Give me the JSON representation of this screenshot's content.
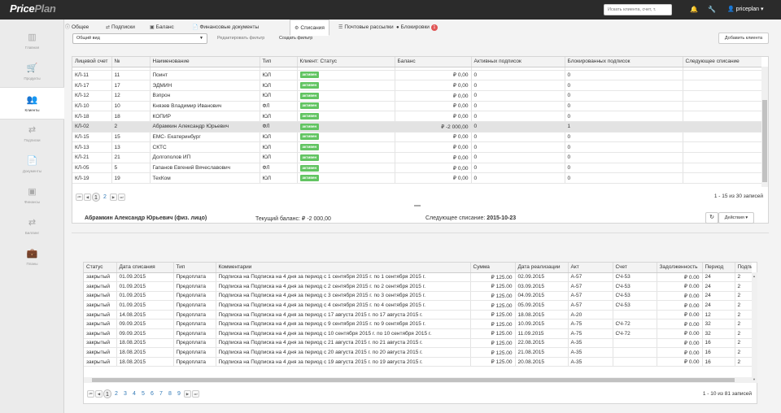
{
  "app": {
    "logo_part1": "Price",
    "logo_part2": "Plan"
  },
  "topbar": {
    "search_placeholder": "Искать клиента, счет, т.",
    "user": "priceplan"
  },
  "sidebar": [
    {
      "label": "Главная",
      "icon": "chart-icon"
    },
    {
      "label": "Продукты",
      "icon": "cart-icon"
    },
    {
      "label": "Клиенты",
      "icon": "users-icon",
      "active": true
    },
    {
      "label": "Подписки",
      "icon": "refresh-icon"
    },
    {
      "label": "Документы",
      "icon": "document-icon"
    },
    {
      "label": "Финансы",
      "icon": "money-icon"
    },
    {
      "label": "Биллинг",
      "icon": "billing-icon"
    },
    {
      "label": "Планы",
      "icon": "briefcase-icon"
    }
  ],
  "toolbar": {
    "view_select": "Общий вид",
    "edit_filter": "Редактировать фильтр",
    "create_filter": "Создать фильтр",
    "add_client": "Добавить клиента"
  },
  "clients": {
    "columns": [
      "Лицевой счет",
      "№",
      "Наименование",
      "Тип",
      "Клиент: Статус",
      "Баланс",
      "Активных подписок",
      "Блокированных подписок",
      "Следующее списание"
    ],
    "rows": [
      [
        "КЛ-11",
        "11",
        "Поинт",
        "ЮЛ",
        "активен",
        "₽ 0,00",
        "0",
        "0",
        ""
      ],
      [
        "КЛ-17",
        "17",
        "ЭДМИН",
        "ЮЛ",
        "активен",
        "₽ 0,00",
        "0",
        "0",
        ""
      ],
      [
        "КЛ-12",
        "12",
        "Взпрон",
        "ЮЛ",
        "активен",
        "₽ 0,00",
        "0",
        "0",
        ""
      ],
      [
        "КЛ-10",
        "10",
        "Князев Владимир Иванович",
        "ФЛ",
        "активен",
        "₽ 0,00",
        "0",
        "0",
        ""
      ],
      [
        "КЛ-18",
        "18",
        "КОПИР",
        "ЮЛ",
        "активен",
        "₽ 0,00",
        "0",
        "0",
        ""
      ],
      [
        "КЛ-02",
        "2",
        "Абрамкин Александр Юрьевич",
        "ФЛ",
        "активен",
        "₽ -2 000,00",
        "0",
        "1",
        ""
      ],
      [
        "КЛ-15",
        "15",
        "ЕМС- Екатеринбург",
        "ЮЛ",
        "активен",
        "₽ 0,00",
        "0",
        "0",
        ""
      ],
      [
        "КЛ-13",
        "13",
        "СКТС",
        "ЮЛ",
        "активен",
        "₽ 0,00",
        "0",
        "0",
        ""
      ],
      [
        "КЛ-21",
        "21",
        "Долгополов ИП",
        "ЮЛ",
        "активен",
        "₽ 0,00",
        "0",
        "0",
        ""
      ],
      [
        "КЛ-05",
        "5",
        "Гапанов Евгений Вячеславович",
        "ФЛ",
        "активен",
        "₽ 0,00",
        "0",
        "0",
        ""
      ],
      [
        "КЛ-19",
        "19",
        "ТехКом",
        "ЮЛ",
        "активен",
        "₽ 0,00",
        "0",
        "0",
        ""
      ]
    ],
    "pages": [
      "1",
      "2"
    ],
    "summary": "1 - 15 из 30 записей"
  },
  "detail": {
    "client": "Абрамкин Александр Юрьевич (физ. лицо)",
    "balance": "Текущий баланс: ₽ -2 000,00",
    "next_charge_label": "Следующее списание:",
    "next_charge": "2015-10-23",
    "actions": "Действия"
  },
  "tabs": [
    {
      "label": "Общее",
      "icon": "info-icon"
    },
    {
      "label": "Подписки",
      "icon": "refresh-icon"
    },
    {
      "label": "Баланс",
      "icon": "money-icon"
    },
    {
      "label": "Финансовые документы",
      "icon": "document-icon"
    },
    {
      "label": "Списания",
      "icon": "gear-icon",
      "active": true
    },
    {
      "label": "Почтовые рассылки",
      "icon": "list-icon"
    },
    {
      "label": "Блокировки",
      "icon": "lock-icon",
      "badge": "1"
    }
  ],
  "charges": {
    "columns": [
      "Статус",
      "Дата списания",
      "Тип",
      "Комментарии",
      "Сумма",
      "Дата реализации",
      "Акт",
      "Счет",
      "Задолженность",
      "Период",
      "Подпи"
    ],
    "rows": [
      [
        "закрытый",
        "01.09.2015",
        "Предоплата",
        "Подписка на Подписка на 4 дня за период с 1 сентября 2015 г. по 1 сентября 2015 г.",
        "₽ 125.00",
        "02.09.2015",
        "А-57",
        "СЧ-53",
        "₽ 0.00",
        "24",
        "2"
      ],
      [
        "закрытый",
        "01.09.2015",
        "Предоплата",
        "Подписка на Подписка на 4 дня за период с 2 сентября 2015 г. по 2 сентября 2015 г.",
        "₽ 125.00",
        "03.09.2015",
        "А-57",
        "СЧ-53",
        "₽ 0.00",
        "24",
        "2"
      ],
      [
        "закрытый",
        "01.09.2015",
        "Предоплата",
        "Подписка на Подписка на 4 дня за период с 3 сентября 2015 г. по 3 сентября 2015 г.",
        "₽ 125.00",
        "04.09.2015",
        "А-57",
        "СЧ-53",
        "₽ 0.00",
        "24",
        "2"
      ],
      [
        "закрытый",
        "01.09.2015",
        "Предоплата",
        "Подписка на Подписка на 4 дня за период с 4 сентября 2015 г. по 4 сентября 2015 г.",
        "₽ 125.00",
        "05.09.2015",
        "А-57",
        "СЧ-53",
        "₽ 0.00",
        "24",
        "2"
      ],
      [
        "закрытый",
        "14.08.2015",
        "Предоплата",
        "Подписка на Подписка на 4 дня за период с 17 августа 2015 г. по 17 августа 2015 г.",
        "₽ 125.00",
        "18.08.2015",
        "А-20",
        "",
        "₽ 0.00",
        "12",
        "2"
      ],
      [
        "закрытый",
        "09.09.2015",
        "Предоплата",
        "Подписка на Подписка на 4 дня за период с 9 сентября 2015 г. по 9 сентября 2015 г.",
        "₽ 125.00",
        "10.09.2015",
        "А-75",
        "СЧ-72",
        "₽ 0.00",
        "32",
        "2"
      ],
      [
        "закрытый",
        "09.09.2015",
        "Предоплата",
        "Подписка на Подписка на 4 дня за период с 10 сентября 2015 г. по 10 сентября 2015 г.",
        "₽ 125.00",
        "11.09.2015",
        "А-75",
        "СЧ-72",
        "₽ 0.00",
        "32",
        "2"
      ],
      [
        "закрытый",
        "18.08.2015",
        "Предоплата",
        "Подписка на Подписка на 4 дня за период с 21 августа 2015 г. по 21 августа 2015 г.",
        "₽ 125.00",
        "22.08.2015",
        "А-35",
        "",
        "₽ 0.00",
        "16",
        "2"
      ],
      [
        "закрытый",
        "18.08.2015",
        "Предоплата",
        "Подписка на Подписка на 4 дня за период с 20 августа 2015 г. по 20 августа 2015 г.",
        "₽ 125.00",
        "21.08.2015",
        "А-35",
        "",
        "₽ 0.00",
        "16",
        "2"
      ],
      [
        "закрытый",
        "18.08.2015",
        "Предоплата",
        "Подписка на Подписка на 4 дня за период с 19 августа 2015 г. по 19 августа 2015 г.",
        "₽ 125.00",
        "20.08.2015",
        "А-35",
        "",
        "₽ 0.00",
        "16",
        "2"
      ]
    ],
    "pages": [
      "1",
      "2",
      "3",
      "4",
      "5",
      "6",
      "7",
      "8",
      "9"
    ],
    "summary": "1 - 10 из 81 записей"
  }
}
